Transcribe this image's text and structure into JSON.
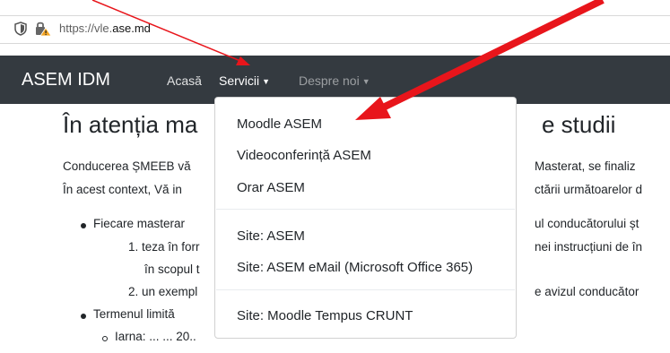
{
  "browser": {
    "url_prefix": "https://vle.",
    "url_host": "ase.md"
  },
  "navbar": {
    "brand": "ASEM IDM",
    "home": "Acasă",
    "services": "Servicii",
    "about": "Despre noi"
  },
  "dropdown": {
    "items": [
      "Moodle ASEM",
      "Videoconferință ASEM",
      "Orar ASEM",
      "Site: ASEM",
      "Site: ASEM eMail (Microsoft Office 365)",
      "Site: Moodle Tempus CRUNT"
    ]
  },
  "content": {
    "heading_left": "În atenția ma",
    "heading_right": "e studii",
    "para1_left": "Conducerea ȘMEEB vă",
    "para1_right": "Masterat, se finaliz",
    "para2_left": "În acest context, Vă in",
    "para2_right": "ctării următoarelor d",
    "li1_left": "Fiecare masterar",
    "li1_right": "ul conducătorului șt",
    "li1a_left": "1. teza în forr",
    "li1a_right": "nei instrucțiuni de în",
    "li1a_cont": "în scopul t",
    "li1b_left": "2. un exempl",
    "li1b_right": "e avizul conducător",
    "li2_left": "Termenul limită",
    "li2a": "Iarna: ... ... 20.."
  },
  "colors": {
    "navbar": "#343a40",
    "arrow": "#e8151b",
    "thin_arrow": "#e8151b"
  }
}
